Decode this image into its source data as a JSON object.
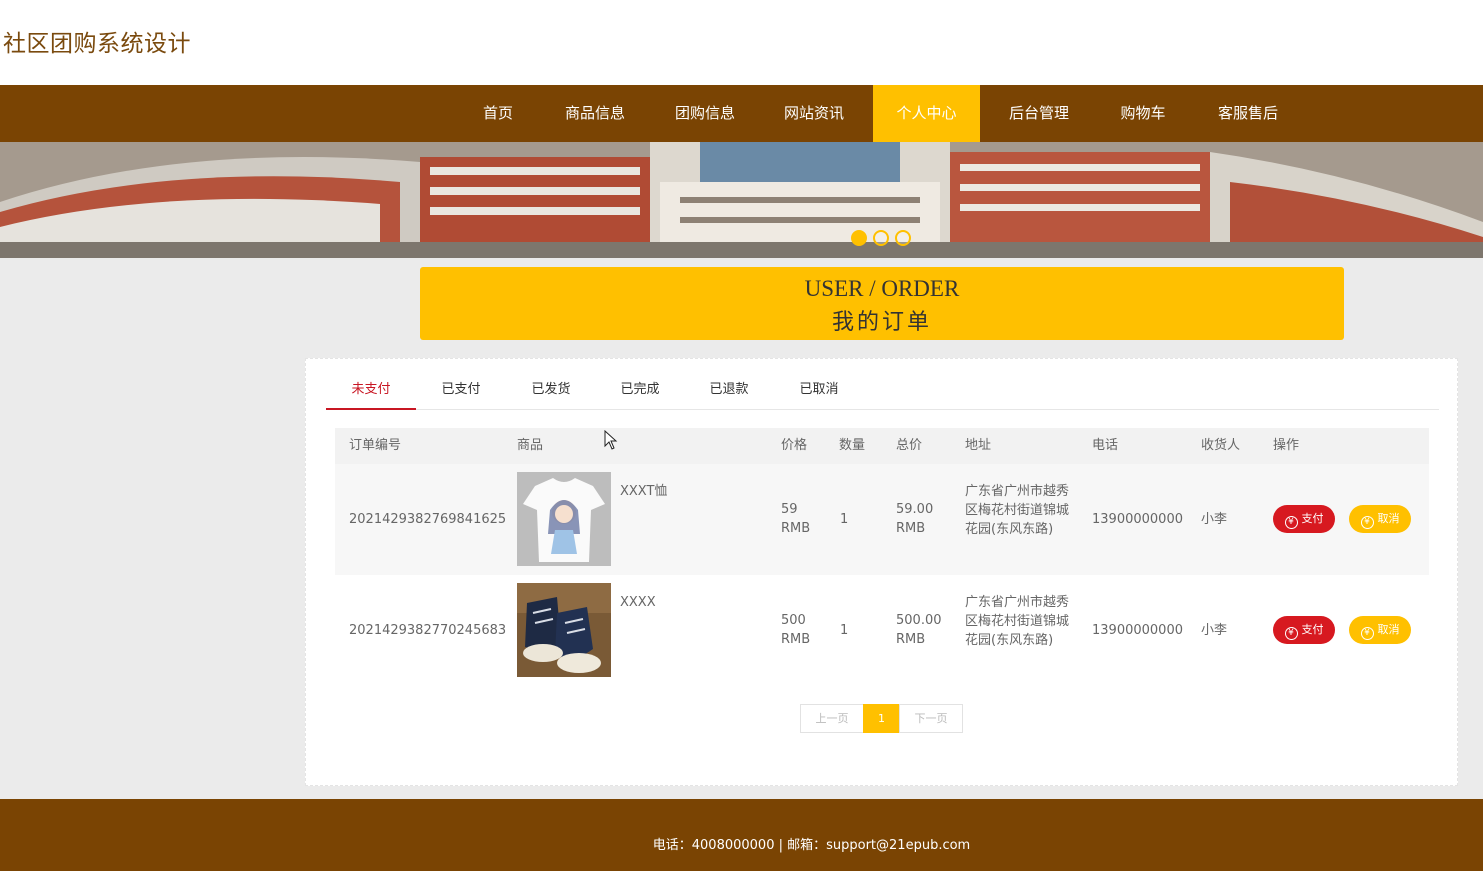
{
  "site": {
    "title": "社区团购系统设计"
  },
  "nav": {
    "items": [
      {
        "label": "首页"
      },
      {
        "label": "商品信息"
      },
      {
        "label": "团购信息"
      },
      {
        "label": "网站资讯"
      },
      {
        "label": "个人中心",
        "active": true
      },
      {
        "label": "后台管理"
      },
      {
        "label": "购物车"
      },
      {
        "label": "客服售后"
      }
    ]
  },
  "banner": {
    "slides": 3,
    "active_slide": 1
  },
  "section": {
    "title_en": "USER / ORDER",
    "title_cn": "我的订单"
  },
  "tabs": [
    {
      "label": "未支付",
      "active": true
    },
    {
      "label": "已支付"
    },
    {
      "label": "已发货"
    },
    {
      "label": "已完成"
    },
    {
      "label": "已退款"
    },
    {
      "label": "已取消"
    }
  ],
  "table": {
    "headers": [
      "订单编号",
      "商品",
      "价格",
      "数量",
      "总价",
      "地址",
      "电话",
      "收货人",
      "操作"
    ],
    "rows": [
      {
        "order_no": "2021429382769841625",
        "product_name": "XXXT恤",
        "product_image": "tshirt-image",
        "price": "59",
        "price_unit": "RMB",
        "qty": "1",
        "total": "59.00",
        "total_unit": "RMB",
        "address": "广东省广州市越秀区梅花村街道锦城花园(东风东路)",
        "phone": "13900000000",
        "receiver": "小李",
        "pay_label": "支付",
        "cancel_label": "取消"
      },
      {
        "order_no": "2021429382770245683",
        "product_name": "XXXX",
        "product_image": "sneaker-image",
        "price": "500",
        "price_unit": "RMB",
        "qty": "1",
        "total": "500.00",
        "total_unit": "RMB",
        "address": "广东省广州市越秀区梅花村街道锦城花园(东风东路)",
        "phone": "13900000000",
        "receiver": "小李",
        "pay_label": "支付",
        "cancel_label": "取消"
      }
    ]
  },
  "pagination": {
    "prev": "上一页",
    "current": "1",
    "next": "下一页"
  },
  "footer": {
    "text": "电话：4008000000 | 邮箱：support@21epub.com"
  },
  "colors": {
    "brand_brown": "#7a4403",
    "accent_yellow": "#ffc000",
    "pay_red": "#d71920"
  }
}
